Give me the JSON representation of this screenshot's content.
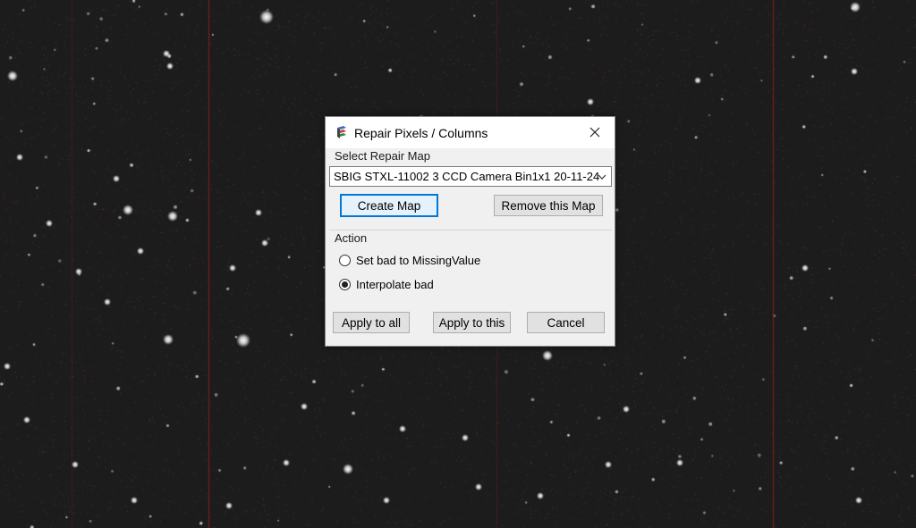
{
  "dialog": {
    "title": "Repair Pixels / Columns",
    "app_icon": "layered-app-icon",
    "close_icon": "close-icon"
  },
  "repair_map": {
    "group_label": "Select Repair Map",
    "selected_value": "SBIG STXL-11002 3 CCD Camera Bin1x1 20-11-24",
    "create_button": "Create Map",
    "remove_button": "Remove this Map"
  },
  "action": {
    "group_label": "Action",
    "options": [
      {
        "label": "Set bad to MissingValue",
        "checked": false
      },
      {
        "label": "Interpolate bad",
        "checked": true
      }
    ]
  },
  "footer": {
    "apply_all": "Apply to all",
    "apply_this": "Apply to this",
    "cancel": "Cancel"
  },
  "colors": {
    "background": "#1c1c1c",
    "column_defect": "#8b1a1a",
    "accent": "#0078d7"
  }
}
